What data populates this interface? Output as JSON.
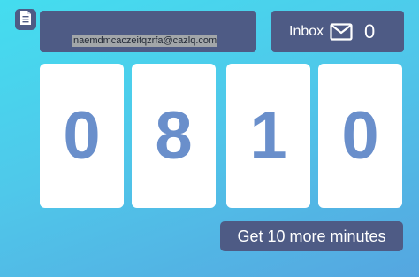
{
  "header": {
    "copy_icon": "document-copy-icon",
    "email": "naemdmcaczeitqzrfa@cazlq.com"
  },
  "inbox": {
    "label": "Inbox",
    "icon": "envelope-icon",
    "count": "0"
  },
  "timer": {
    "digits": [
      "0",
      "8",
      "1",
      "0"
    ]
  },
  "actions": {
    "more_minutes_label": "Get 10 more minutes"
  },
  "colors": {
    "panel": "#4e5b85",
    "digit": "#6a8fcb",
    "background_top": "#44ddef",
    "background_bottom": "#55a6e0"
  }
}
